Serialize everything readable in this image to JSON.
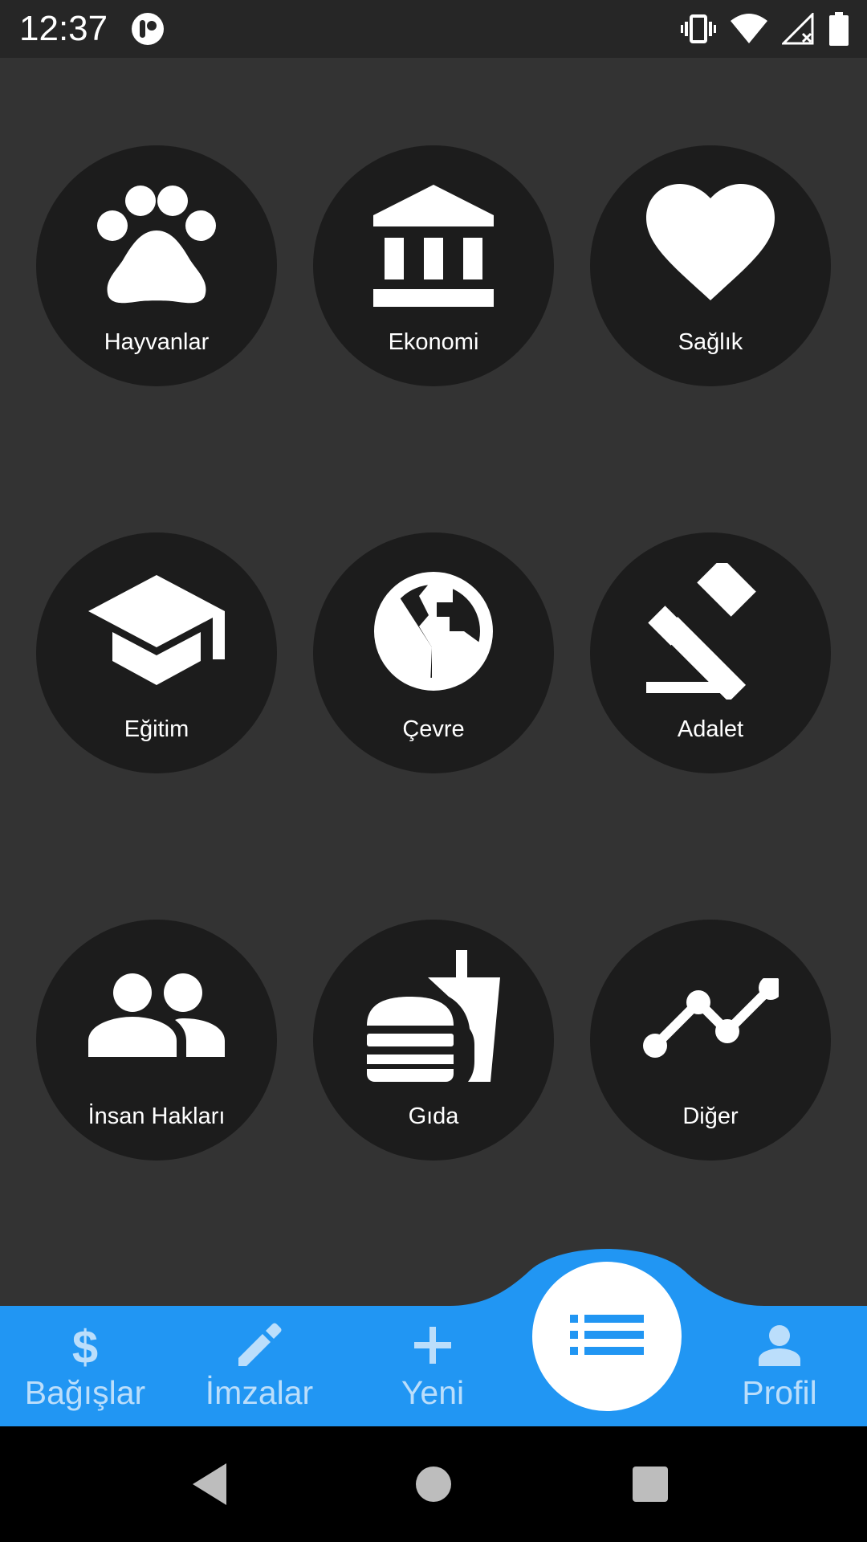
{
  "status_bar": {
    "time": "12:37"
  },
  "categories": [
    {
      "label": "Hayvanlar",
      "icon": "paw-icon"
    },
    {
      "label": "Ekonomi",
      "icon": "bank-icon"
    },
    {
      "label": "Sağlık",
      "icon": "heart-icon"
    },
    {
      "label": "Eğitim",
      "icon": "graduation-cap-icon"
    },
    {
      "label": "Çevre",
      "icon": "globe-icon"
    },
    {
      "label": "Adalet",
      "icon": "gavel-icon"
    },
    {
      "label": "İnsan Hakları",
      "icon": "people-icon"
    },
    {
      "label": "Gıda",
      "icon": "fastfood-icon"
    },
    {
      "label": "Diğer",
      "icon": "trending-icon"
    }
  ],
  "bottom_nav": {
    "items": [
      {
        "label": "Bağışlar",
        "icon": "dollar-icon"
      },
      {
        "label": "İmzalar",
        "icon": "pencil-icon"
      },
      {
        "label": "Yeni",
        "icon": "plus-icon"
      },
      {
        "label": "Profil",
        "icon": "person-icon"
      }
    ],
    "center_icon": "list-icon"
  },
  "colors": {
    "background": "#333333",
    "tile": "#1c1c1c",
    "nav_bar": "#2196f3",
    "nav_item": "#bbdefb",
    "status_bar": "#262626"
  }
}
